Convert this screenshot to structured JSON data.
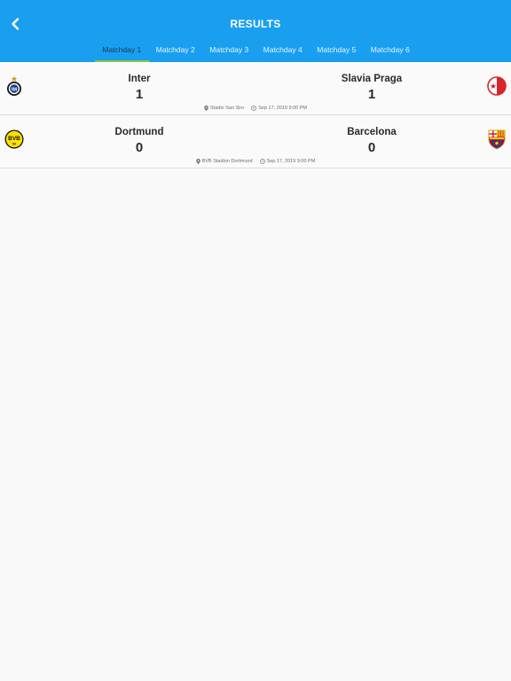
{
  "header": {
    "title": "RESULTS",
    "back_icon": "chevron-left-icon"
  },
  "tabs": [
    {
      "label": "Matchday 1",
      "active": true
    },
    {
      "label": "Matchday 2",
      "active": false
    },
    {
      "label": "Matchday 3",
      "active": false
    },
    {
      "label": "Matchday 4",
      "active": false
    },
    {
      "label": "Matchday 5",
      "active": false
    },
    {
      "label": "Matchday 6",
      "active": false
    }
  ],
  "matches": [
    {
      "home": {
        "name": "Inter",
        "score": "1",
        "logo": "inter-logo-icon"
      },
      "away": {
        "name": "Slavia Praga",
        "score": "1",
        "logo": "slavia-praga-logo-icon"
      },
      "venue": "Stadio San Siro",
      "datetime": "Sep 17, 2019 9:00 PM"
    },
    {
      "home": {
        "name": "Dortmund",
        "score": "0",
        "logo": "dortmund-logo-icon"
      },
      "away": {
        "name": "Barcelona",
        "score": "0",
        "logo": "barcelona-logo-icon"
      },
      "venue": "BVB Stadion Dortmund",
      "datetime": "Sep 17, 2019 9:00 PM"
    }
  ],
  "colors": {
    "header_bg": "#1a9ff0",
    "active_tab_underline": "#8bc34a",
    "active_tab_text": "#173a55"
  }
}
